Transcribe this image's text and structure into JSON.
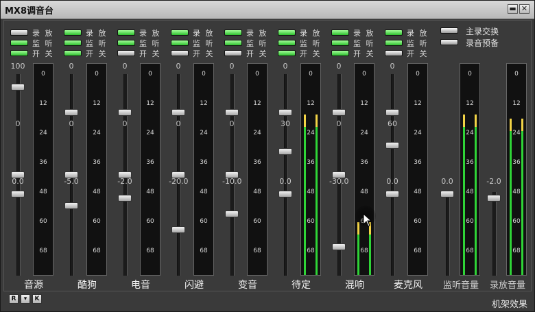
{
  "window": {
    "title": "MX8调音台",
    "minimize_glyph": "▬",
    "close_glyph": "✕"
  },
  "switch_labels": {
    "record_play": "录 放",
    "monitor": "监 听",
    "on_off": "开 关"
  },
  "meter_scale": [
    "0",
    "12",
    "24",
    "36",
    "48",
    "60",
    "68"
  ],
  "channels": [
    {
      "name": "音源",
      "switches": [
        "off",
        "on",
        "on"
      ],
      "faders": [
        {
          "label": "100",
          "pos": 0.05
        },
        {
          "label": "0",
          "pos": 0.5
        },
        {
          "label": "0.0",
          "pos": 0.6
        }
      ],
      "levels": [
        0,
        0
      ]
    },
    {
      "name": "酷狗",
      "switches": [
        "on",
        "on",
        "on"
      ],
      "faders": [
        {
          "label": "0",
          "pos": 0.18
        },
        {
          "label": "0",
          "pos": 0.5
        },
        {
          "label": "-5.0",
          "pos": 0.66
        }
      ],
      "levels": [
        0,
        0
      ]
    },
    {
      "name": "电音",
      "switches": [
        "on",
        "on",
        "off"
      ],
      "faders": [
        {
          "label": "0",
          "pos": 0.18
        },
        {
          "label": "0",
          "pos": 0.5
        },
        {
          "label": "-2.0",
          "pos": 0.62
        }
      ],
      "levels": [
        0,
        0
      ]
    },
    {
      "name": "闪避",
      "switches": [
        "on",
        "on",
        "off"
      ],
      "faders": [
        {
          "label": "0",
          "pos": 0.18
        },
        {
          "label": "0",
          "pos": 0.5
        },
        {
          "label": "-20.0",
          "pos": 0.78
        }
      ],
      "levels": [
        0,
        0
      ]
    },
    {
      "name": "变音",
      "switches": [
        "on",
        "on",
        "off"
      ],
      "faders": [
        {
          "label": "0",
          "pos": 0.18
        },
        {
          "label": "0",
          "pos": 0.5
        },
        {
          "label": "-10.0",
          "pos": 0.7
        }
      ],
      "levels": [
        0,
        0
      ]
    },
    {
      "name": "待定",
      "switches": [
        "on",
        "on",
        "on"
      ],
      "faders": [
        {
          "label": "0",
          "pos": 0.18
        },
        {
          "label": "30",
          "pos": 0.38
        },
        {
          "label": "0.0",
          "pos": 0.6
        }
      ],
      "levels": [
        0.76,
        0.76
      ]
    },
    {
      "name": "混响",
      "switches": [
        "on",
        "on",
        "on"
      ],
      "faders": [
        {
          "label": "0",
          "pos": 0.18
        },
        {
          "label": "0",
          "pos": 0.5
        },
        {
          "label": "-30.0",
          "pos": 0.87
        }
      ],
      "levels": [
        0.25,
        0.25
      ]
    },
    {
      "name": "麦克风",
      "switches": [
        "on",
        "on",
        "off"
      ],
      "faders": [
        {
          "label": "0",
          "pos": 0.18
        },
        {
          "label": "60",
          "pos": 0.35
        },
        {
          "label": "0.0",
          "pos": 0.6
        }
      ],
      "levels": [
        0,
        0
      ]
    }
  ],
  "masters": [
    {
      "name": "监听音量",
      "fader": {
        "label": "0.0",
        "pos": 0.6
      },
      "levels": [
        0.76,
        0.76
      ]
    },
    {
      "name": "录放音量",
      "fader": {
        "label": "-2.0",
        "pos": 0.62
      },
      "levels": [
        0.74,
        0.74
      ]
    }
  ],
  "options": {
    "main_record_swap": "主录交换",
    "record_preview": "录音预备"
  },
  "bottom": {
    "r_label": "R",
    "mid_glyph": "▾",
    "k_label": "K",
    "rack_effects": "机架效果"
  }
}
